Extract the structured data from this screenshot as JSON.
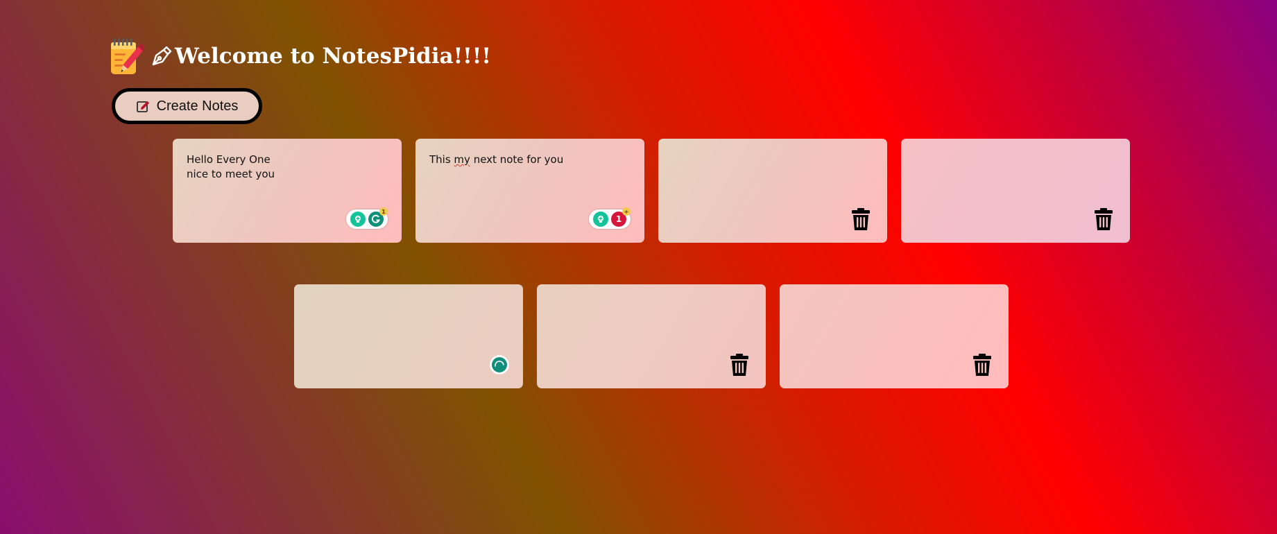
{
  "header": {
    "memo_icon": "memo-emoji-icon",
    "pen_icon": "fountain-pen-icon",
    "title": "Welcome to NotesPidia!!!!"
  },
  "actions": {
    "create_label": "Create Notes",
    "create_icon": "edit-square-icon"
  },
  "notes": [
    {
      "text": "Hello Every One\nnice to meet you",
      "footer": "grammarly-extension",
      "badge": "1"
    },
    {
      "text_before": "This ",
      "text_spell": "my",
      "text_after": " next note for you",
      "footer": "grammarly-extension",
      "badge": "1"
    },
    {
      "text": "",
      "footer": "trash"
    },
    {
      "text": "",
      "footer": "trash"
    },
    {
      "text": "",
      "footer": "loading-extension"
    },
    {
      "text": "",
      "footer": "trash"
    },
    {
      "text": "",
      "footer": "trash"
    }
  ],
  "colors": {
    "grammarly_green": "#15c39a",
    "grammarly_dark": "#0f8f7a",
    "alert_red": "#d6163a",
    "badge_yellow": "#f2c94c",
    "button_bg": "#e9cdc0"
  }
}
